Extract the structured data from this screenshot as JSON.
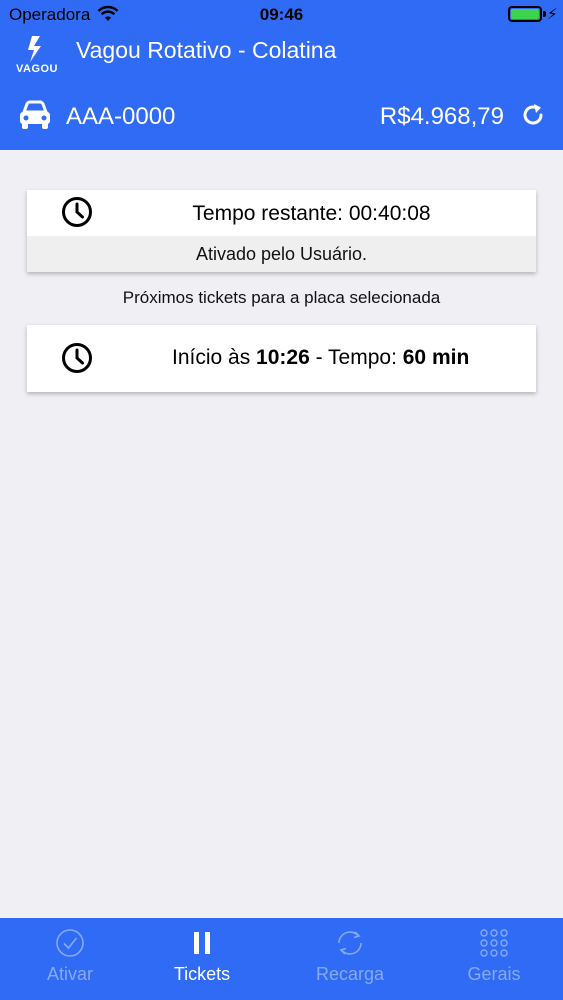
{
  "status_bar": {
    "carrier": "Operadora",
    "time": "09:46"
  },
  "nav": {
    "logo_text": "VAGOU",
    "title": "Vagou Rotativo - Colatina"
  },
  "plate_bar": {
    "plate": "AAA-0000",
    "balance": "R$4.968,79",
    "icons": [
      "car-icon",
      "refresh-icon"
    ]
  },
  "active_ticket": {
    "remaining_label": "Tempo restante: 00:40:08",
    "activated_by": "Ativado pelo Usuário.",
    "icon": "clock-icon"
  },
  "next_tickets": {
    "section_label": "Próximos tickets para a placa selecionada",
    "items": [
      {
        "start_prefix": "Início às ",
        "start_time": "10:26",
        "separator": " - Tempo: ",
        "duration": "60 min",
        "icon": "clock-icon"
      }
    ]
  },
  "tab_bar": {
    "tabs": [
      {
        "label": "Ativar",
        "icon": "check-circle-icon",
        "active": false
      },
      {
        "label": "Tickets",
        "icon": "pause-icon",
        "active": true
      },
      {
        "label": "Recarga",
        "icon": "sync-icon",
        "active": false
      },
      {
        "label": "Gerais",
        "icon": "grid-icon",
        "active": false
      }
    ]
  },
  "colors": {
    "primary": "#2f6bf5",
    "background": "#efeff4",
    "tab_inactive": "#86a9f5",
    "battery": "#3cd44d"
  }
}
